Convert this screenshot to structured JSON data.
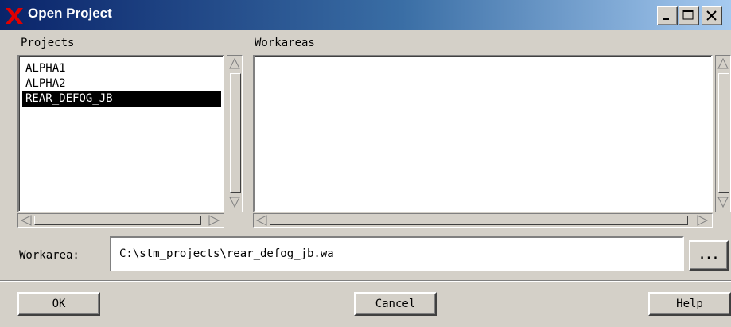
{
  "window": {
    "title": "Open Project",
    "minimize_symbol": "_",
    "maximize_symbol": "□",
    "close_symbol": "X"
  },
  "projects": {
    "label": "Projects",
    "items": [
      {
        "label": "ALPHA1",
        "selected": false
      },
      {
        "label": "ALPHA2",
        "selected": false
      },
      {
        "label": "REAR_DEFOG_JB",
        "selected": true
      }
    ]
  },
  "workareas": {
    "label": "Workareas",
    "items": []
  },
  "workarea_field": {
    "label": "Workarea:",
    "value": "C:\\stm_projects\\rear_defog_jb.wa",
    "browse_label": "..."
  },
  "buttons": {
    "ok": "OK",
    "cancel": "Cancel",
    "help": "Help"
  },
  "colors": {
    "titlebar_start": "#0a246a",
    "titlebar_end": "#a6caf0",
    "app_icon": "#e00000",
    "dialog_bg": "#d4d0c8",
    "selection_bg": "#000000"
  }
}
